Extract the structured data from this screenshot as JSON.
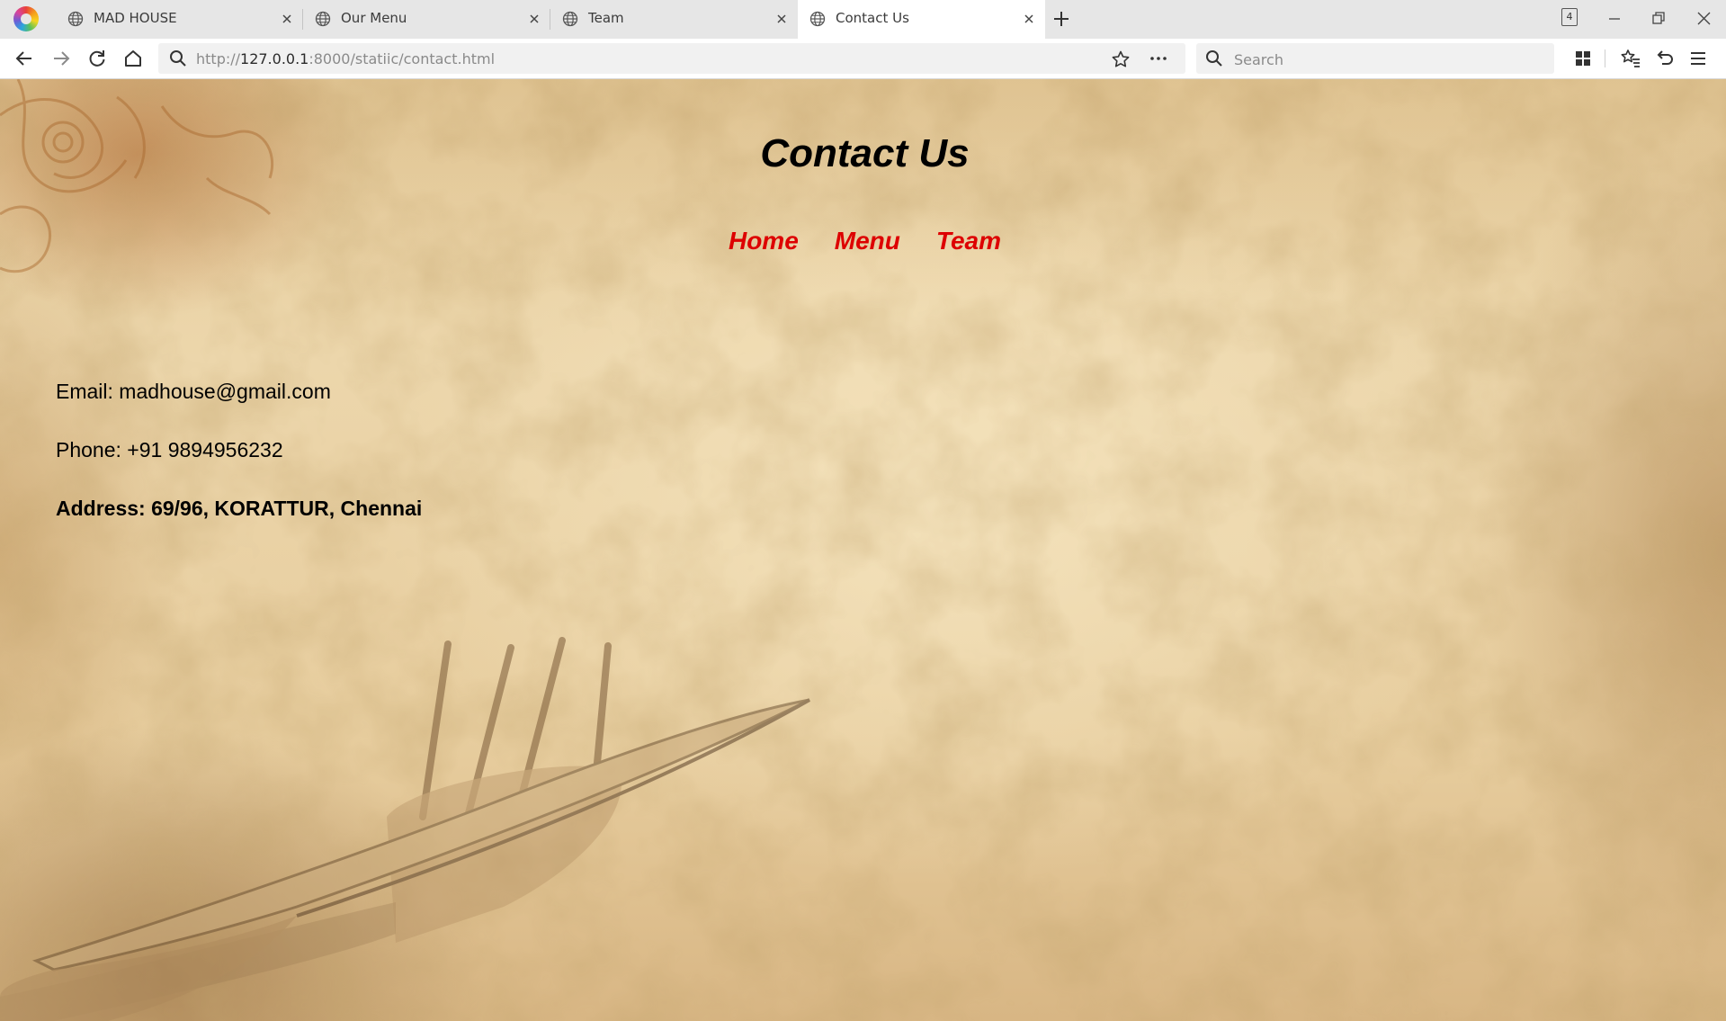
{
  "browser": {
    "tabs": [
      {
        "title": "MAD HOUSE",
        "active": false
      },
      {
        "title": "Our Menu",
        "active": false
      },
      {
        "title": "Team",
        "active": false
      },
      {
        "title": "Contact Us",
        "active": true
      }
    ],
    "tab_count": "4",
    "url_prefix": "http://",
    "url_host": "127.0.0.1",
    "url_rest": ":8000/statiic/contact.html",
    "search_placeholder": "Search"
  },
  "page": {
    "title": "Contact Us",
    "nav": [
      {
        "label": "Home"
      },
      {
        "label": "Menu"
      },
      {
        "label": "Team"
      }
    ],
    "contact": {
      "email": "Email: madhouse@gmail.com",
      "phone": "Phone: +91 9894956232",
      "address": "Address: 69/96, KORATTUR, Chennai"
    }
  },
  "colors": {
    "nav_link": "#dd0000",
    "title": "#000000",
    "active_tab": "#ffffff",
    "tabstrip": "#e6e6e6"
  },
  "icons": [
    "browser-logo-icon",
    "globe-icon",
    "close-icon",
    "plus-icon",
    "back-arrow-icon",
    "forward-arrow-icon",
    "reload-icon",
    "home-icon",
    "search-icon",
    "star-icon",
    "more-icon",
    "grid-icon",
    "bookmarks-icon",
    "undo-icon",
    "menu-icon",
    "minimize-icon",
    "restore-icon"
  ]
}
